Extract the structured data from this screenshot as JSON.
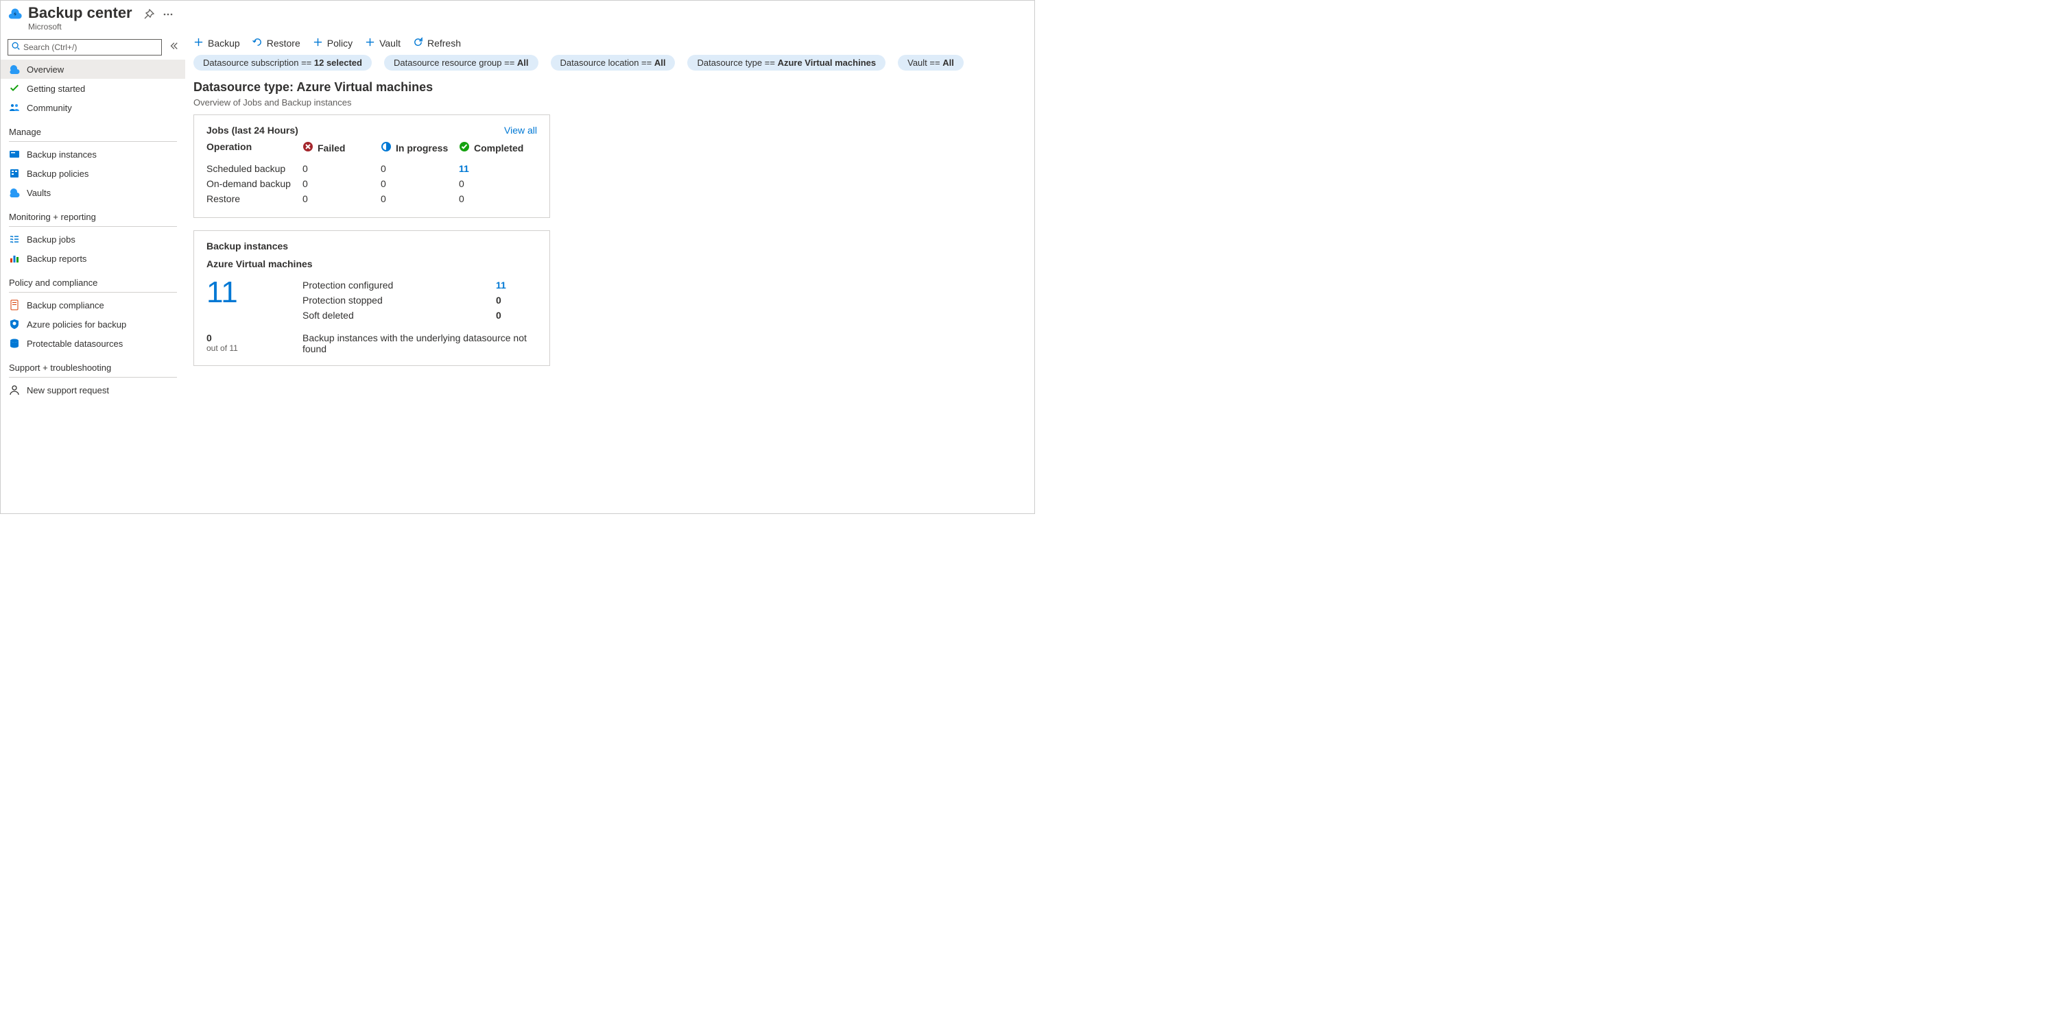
{
  "header": {
    "title": "Backup center",
    "subtitle": "Microsoft"
  },
  "search": {
    "placeholder": "Search (Ctrl+/)"
  },
  "sidebar": {
    "top": [
      {
        "label": "Overview"
      },
      {
        "label": "Getting started"
      },
      {
        "label": "Community"
      }
    ],
    "sections": [
      {
        "title": "Manage",
        "items": [
          {
            "label": "Backup instances"
          },
          {
            "label": "Backup policies"
          },
          {
            "label": "Vaults"
          }
        ]
      },
      {
        "title": "Monitoring + reporting",
        "items": [
          {
            "label": "Backup jobs"
          },
          {
            "label": "Backup reports"
          }
        ]
      },
      {
        "title": "Policy and compliance",
        "items": [
          {
            "label": "Backup compliance"
          },
          {
            "label": "Azure policies for backup"
          },
          {
            "label": "Protectable datasources"
          }
        ]
      },
      {
        "title": "Support + troubleshooting",
        "items": [
          {
            "label": "New support request"
          }
        ]
      }
    ]
  },
  "toolbar": {
    "backup": "Backup",
    "restore": "Restore",
    "policy": "Policy",
    "vault": "Vault",
    "refresh": "Refresh"
  },
  "filters": {
    "subscription_prefix": "Datasource subscription == ",
    "subscription_value": "12 selected",
    "rg_prefix": "Datasource resource group == ",
    "rg_value": "All",
    "location_prefix": "Datasource location == ",
    "location_value": "All",
    "type_prefix": "Datasource type == ",
    "type_value": "Azure Virtual machines",
    "vault_prefix": "Vault == ",
    "vault_value": "All"
  },
  "overview": {
    "title": "Datasource type: Azure Virtual machines",
    "subtitle": "Overview of Jobs and Backup instances"
  },
  "jobs": {
    "title": "Jobs (last 24 Hours)",
    "view_all": "View all",
    "head": {
      "operation": "Operation",
      "failed": "Failed",
      "inprogress": "In progress",
      "completed": "Completed"
    },
    "rows": [
      {
        "op": "Scheduled backup",
        "failed": "0",
        "inprogress": "0",
        "completed": "11",
        "completed_link": true
      },
      {
        "op": "On-demand backup",
        "failed": "0",
        "inprogress": "0",
        "completed": "0",
        "completed_link": false
      },
      {
        "op": "Restore",
        "failed": "0",
        "inprogress": "0",
        "completed": "0",
        "completed_link": false
      }
    ]
  },
  "instances": {
    "title": "Backup instances",
    "subtitle": "Azure Virtual machines",
    "total": "11",
    "rows": [
      {
        "label": "Protection configured",
        "value": "11",
        "link": true
      },
      {
        "label": "Protection stopped",
        "value": "0",
        "link": false
      },
      {
        "label": "Soft deleted",
        "value": "0",
        "link": false
      }
    ],
    "footer_num": "0",
    "footer_note": "out of 11",
    "footer_text": "Backup instances with the underlying datasource not found"
  }
}
